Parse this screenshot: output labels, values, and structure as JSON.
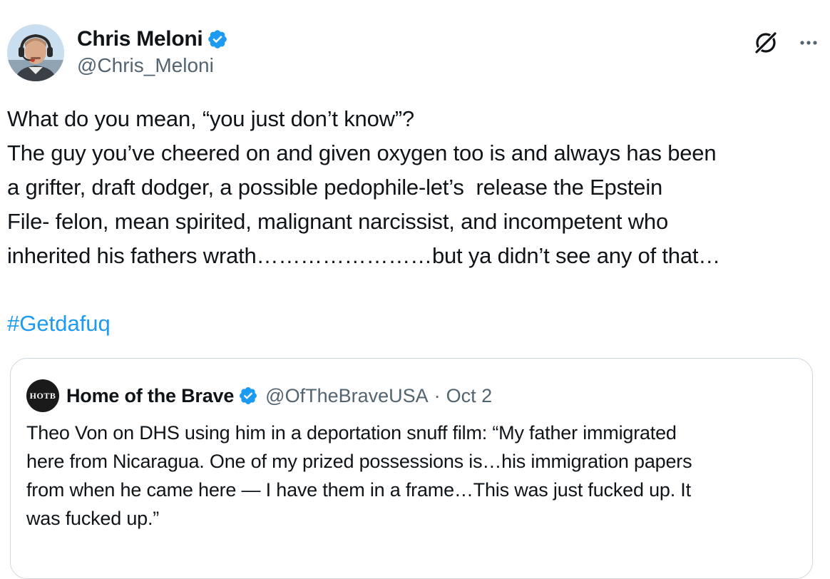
{
  "tweet": {
    "author": {
      "display_name": "Chris Meloni",
      "handle": "@Chris_Meloni",
      "verified": true
    },
    "text_lines": [
      "What do you mean, “you just don’t know”?",
      "The guy you’ve cheered on and given oxygen too is and always has been",
      "a grifter, draft dodger, a possible pedophile-let’s  release the Epstein",
      "File- felon, mean spirited, malignant narcissist, and incompetent who",
      "inherited his fathers wrath……………………but ya didn’t see any of that…"
    ],
    "hashtag": "#Getdafuq",
    "icons": {
      "grok": "grok-icon",
      "more": "more-options-icon",
      "verified": "verified-badge-icon"
    },
    "colors": {
      "link": "#1d9bf0",
      "secondary_text": "#536471",
      "border": "#cfd9de",
      "verified": "#1d9bf0"
    }
  },
  "quoted_tweet": {
    "avatar_text": "HOTB",
    "display_name": "Home of the Brave",
    "handle": "@OfTheBraveUSA",
    "separator": "·",
    "date": "Oct 2",
    "verified": true,
    "text_lines": [
      "Theo Von on DHS using him in a deportation snuff film: “My father immigrated",
      "here from Nicaragua. One of my prized possessions is…his immigration papers",
      "from when he came here — I have them in a frame…This was just fucked up. It",
      "was fucked up.”"
    ]
  }
}
